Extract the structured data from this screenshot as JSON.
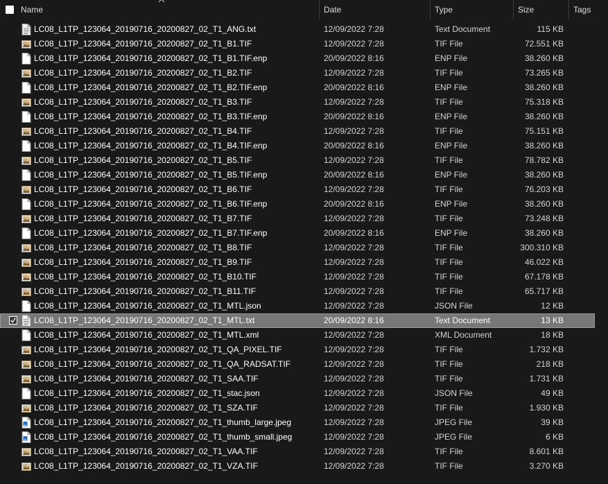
{
  "columns": {
    "name": "Name",
    "date": "Date",
    "type": "Type",
    "size": "Size",
    "tags": "Tags"
  },
  "files": [
    {
      "name": "LC08_L1TP_123064_20190716_20200827_02_T1_ANG.txt",
      "date": "12/09/2022 7:28",
      "type": "Text Document",
      "size": "115 KB",
      "icon": "text-file-icon"
    },
    {
      "name": "LC08_L1TP_123064_20190716_20200827_02_T1_B1.TIF",
      "date": "12/09/2022 7:28",
      "type": "TIF File",
      "size": "72.551 KB",
      "icon": "image-file-icon"
    },
    {
      "name": "LC08_L1TP_123064_20190716_20200827_02_T1_B1.TIF.enp",
      "date": "20/09/2022 8:16",
      "type": "ENP File",
      "size": "38.260 KB",
      "icon": "blank-file-icon"
    },
    {
      "name": "LC08_L1TP_123064_20190716_20200827_02_T1_B2.TIF",
      "date": "12/09/2022 7:28",
      "type": "TIF File",
      "size": "73.265 KB",
      "icon": "image-file-icon"
    },
    {
      "name": "LC08_L1TP_123064_20190716_20200827_02_T1_B2.TIF.enp",
      "date": "20/09/2022 8:16",
      "type": "ENP File",
      "size": "38.260 KB",
      "icon": "blank-file-icon"
    },
    {
      "name": "LC08_L1TP_123064_20190716_20200827_02_T1_B3.TIF",
      "date": "12/09/2022 7:28",
      "type": "TIF File",
      "size": "75.318 KB",
      "icon": "image-file-icon"
    },
    {
      "name": "LC08_L1TP_123064_20190716_20200827_02_T1_B3.TIF.enp",
      "date": "20/09/2022 8:16",
      "type": "ENP File",
      "size": "38.260 KB",
      "icon": "blank-file-icon"
    },
    {
      "name": "LC08_L1TP_123064_20190716_20200827_02_T1_B4.TIF",
      "date": "12/09/2022 7:28",
      "type": "TIF File",
      "size": "75.151 KB",
      "icon": "image-file-icon"
    },
    {
      "name": "LC08_L1TP_123064_20190716_20200827_02_T1_B4.TIF.enp",
      "date": "20/09/2022 8:16",
      "type": "ENP File",
      "size": "38.260 KB",
      "icon": "blank-file-icon"
    },
    {
      "name": "LC08_L1TP_123064_20190716_20200827_02_T1_B5.TIF",
      "date": "12/09/2022 7:28",
      "type": "TIF File",
      "size": "78.782 KB",
      "icon": "image-file-icon"
    },
    {
      "name": "LC08_L1TP_123064_20190716_20200827_02_T1_B5.TIF.enp",
      "date": "20/09/2022 8:16",
      "type": "ENP File",
      "size": "38.260 KB",
      "icon": "blank-file-icon"
    },
    {
      "name": "LC08_L1TP_123064_20190716_20200827_02_T1_B6.TIF",
      "date": "12/09/2022 7:28",
      "type": "TIF File",
      "size": "76.203 KB",
      "icon": "image-file-icon"
    },
    {
      "name": "LC08_L1TP_123064_20190716_20200827_02_T1_B6.TIF.enp",
      "date": "20/09/2022 8:16",
      "type": "ENP File",
      "size": "38.260 KB",
      "icon": "blank-file-icon"
    },
    {
      "name": "LC08_L1TP_123064_20190716_20200827_02_T1_B7.TIF",
      "date": "12/09/2022 7:28",
      "type": "TIF File",
      "size": "73.248 KB",
      "icon": "image-file-icon"
    },
    {
      "name": "LC08_L1TP_123064_20190716_20200827_02_T1_B7.TIF.enp",
      "date": "20/09/2022 8:16",
      "type": "ENP File",
      "size": "38.260 KB",
      "icon": "blank-file-icon"
    },
    {
      "name": "LC08_L1TP_123064_20190716_20200827_02_T1_B8.TIF",
      "date": "12/09/2022 7:28",
      "type": "TIF File",
      "size": "300.310 KB",
      "icon": "image-file-icon"
    },
    {
      "name": "LC08_L1TP_123064_20190716_20200827_02_T1_B9.TIF",
      "date": "12/09/2022 7:28",
      "type": "TIF File",
      "size": "46.022 KB",
      "icon": "image-file-icon"
    },
    {
      "name": "LC08_L1TP_123064_20190716_20200827_02_T1_B10.TIF",
      "date": "12/09/2022 7:28",
      "type": "TIF File",
      "size": "67.178 KB",
      "icon": "image-file-icon"
    },
    {
      "name": "LC08_L1TP_123064_20190716_20200827_02_T1_B11.TIF",
      "date": "12/09/2022 7:28",
      "type": "TIF File",
      "size": "65.717 KB",
      "icon": "image-file-icon"
    },
    {
      "name": "LC08_L1TP_123064_20190716_20200827_02_T1_MTL.json",
      "date": "12/09/2022 7:28",
      "type": "JSON File",
      "size": "12 KB",
      "icon": "blank-file-icon"
    },
    {
      "name": "LC08_L1TP_123064_20190716_20200827_02_T1_MTL.txt",
      "date": "20/09/2022 8:16",
      "type": "Text Document",
      "size": "13 KB",
      "icon": "text-file-icon",
      "selected": true
    },
    {
      "name": "LC08_L1TP_123064_20190716_20200827_02_T1_MTL.xml",
      "date": "12/09/2022 7:28",
      "type": "XML Document",
      "size": "18 KB",
      "icon": "blank-file-icon"
    },
    {
      "name": "LC08_L1TP_123064_20190716_20200827_02_T1_QA_PIXEL.TIF",
      "date": "12/09/2022 7:28",
      "type": "TIF File",
      "size": "1.732 KB",
      "icon": "image-file-icon"
    },
    {
      "name": "LC08_L1TP_123064_20190716_20200827_02_T1_QA_RADSAT.TIF",
      "date": "12/09/2022 7:28",
      "type": "TIF File",
      "size": "218 KB",
      "icon": "image-file-icon"
    },
    {
      "name": "LC08_L1TP_123064_20190716_20200827_02_T1_SAA.TIF",
      "date": "12/09/2022 7:28",
      "type": "TIF File",
      "size": "1.731 KB",
      "icon": "image-file-icon"
    },
    {
      "name": "LC08_L1TP_123064_20190716_20200827_02_T1_stac.json",
      "date": "12/09/2022 7:28",
      "type": "JSON File",
      "size": "49 KB",
      "icon": "blank-file-icon"
    },
    {
      "name": "LC08_L1TP_123064_20190716_20200827_02_T1_SZA.TIF",
      "date": "12/09/2022 7:28",
      "type": "TIF File",
      "size": "1.930 KB",
      "icon": "image-file-icon"
    },
    {
      "name": "LC08_L1TP_123064_20190716_20200827_02_T1_thumb_large.jpeg",
      "date": "12/09/2022 7:28",
      "type": "JPEG File",
      "size": "39 KB",
      "icon": "jpeg-file-icon"
    },
    {
      "name": "LC08_L1TP_123064_20190716_20200827_02_T1_thumb_small.jpeg",
      "date": "12/09/2022 7:28",
      "type": "JPEG File",
      "size": "6 KB",
      "icon": "jpeg-file-icon"
    },
    {
      "name": "LC08_L1TP_123064_20190716_20200827_02_T1_VAA.TIF",
      "date": "12/09/2022 7:28",
      "type": "TIF File",
      "size": "8.601 KB",
      "icon": "image-file-icon"
    },
    {
      "name": "LC08_L1TP_123064_20190716_20200827_02_T1_VZA.TIF",
      "date": "12/09/2022 7:28",
      "type": "TIF File",
      "size": "3.270 KB",
      "icon": "image-file-icon"
    }
  ],
  "colors": {
    "background": "#191919",
    "selection": "#777777",
    "separator": "#3c3c3c"
  }
}
